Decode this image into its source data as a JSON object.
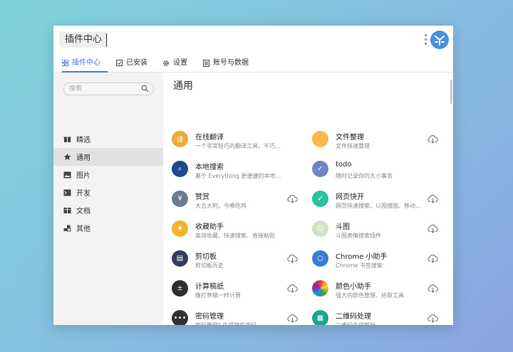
{
  "app": {
    "title": "插件中心"
  },
  "tabs": [
    {
      "label": "插件中心",
      "icon": "grid-icon"
    },
    {
      "label": "已安装",
      "icon": "check-square-icon"
    },
    {
      "label": "设置",
      "icon": "gear-icon"
    },
    {
      "label": "账号与数据",
      "icon": "document-icon"
    }
  ],
  "sidebar": {
    "search_placeholder": "搜索",
    "items": [
      {
        "label": "精选",
        "icon": "gift-icon"
      },
      {
        "label": "通用",
        "icon": "star-icon"
      },
      {
        "label": "图片",
        "icon": "image-icon"
      },
      {
        "label": "开发",
        "icon": "terminal-icon"
      },
      {
        "label": "文档",
        "icon": "book-icon"
      },
      {
        "label": "其他",
        "icon": "blocks-icon"
      }
    ]
  },
  "main": {
    "title": "通用",
    "plugins": [
      {
        "name": "在线翻译",
        "desc": "一个非常轻巧的翻译工具，不巧...",
        "color": "#f0a93a",
        "glyph": "译",
        "download": false
      },
      {
        "name": "文件整理",
        "desc": "文件快速整理",
        "color": "#f7b84b",
        "glyph": "",
        "download": true
      },
      {
        "name": "本地搜索",
        "desc": "基于 Everything 更便捷的本地搜...",
        "color": "#1f4a8c",
        "glyph": "⌕",
        "download": false
      },
      {
        "name": "todo",
        "desc": "随时记录你的大小事务",
        "color": "#6e86c9",
        "glyph": "✓",
        "download": false
      },
      {
        "name": "赞赏",
        "desc": "大吉大利，今晚吃鸡",
        "color": "#6a7a92",
        "glyph": "¥",
        "download": true
      },
      {
        "name": "网页快开",
        "desc": "网页快速搜索、以图搜图、移动...",
        "color": "#2ebfa0",
        "glyph": "➶",
        "download": true
      },
      {
        "name": "收藏助手",
        "desc": "高效收藏、快速搜索、直接粘贴",
        "color": "#f0b42a",
        "glyph": "★",
        "download": false
      },
      {
        "name": "斗图",
        "desc": "斗图表情搜索插件",
        "color": "#cfe3c4",
        "glyph": "☺",
        "download": true
      },
      {
        "name": "剪切板",
        "desc": "剪切板历史",
        "color": "#343c5a",
        "glyph": "▤",
        "download": true
      },
      {
        "name": "Chrome 小助手",
        "desc": "Chrome 书签搜索",
        "color": "#3a7bd5",
        "glyph": "○",
        "download": true
      },
      {
        "name": "计算稿纸",
        "desc": "像打草稿一样计算",
        "color": "#2b2d31",
        "glyph": "±",
        "download": true
      },
      {
        "name": "颜色小助手",
        "desc": "强大的颜色管理、拾取工具",
        "color": "conic",
        "glyph": "",
        "download": true
      },
      {
        "name": "密码管理",
        "desc": "密码管理&生成随机密码",
        "color": "#2e3036",
        "glyph": "•••",
        "download": true
      },
      {
        "name": "二维码处理",
        "desc": "二维码生成解析",
        "color": "#1fa38a",
        "glyph": "▦",
        "download": true
      }
    ]
  }
}
